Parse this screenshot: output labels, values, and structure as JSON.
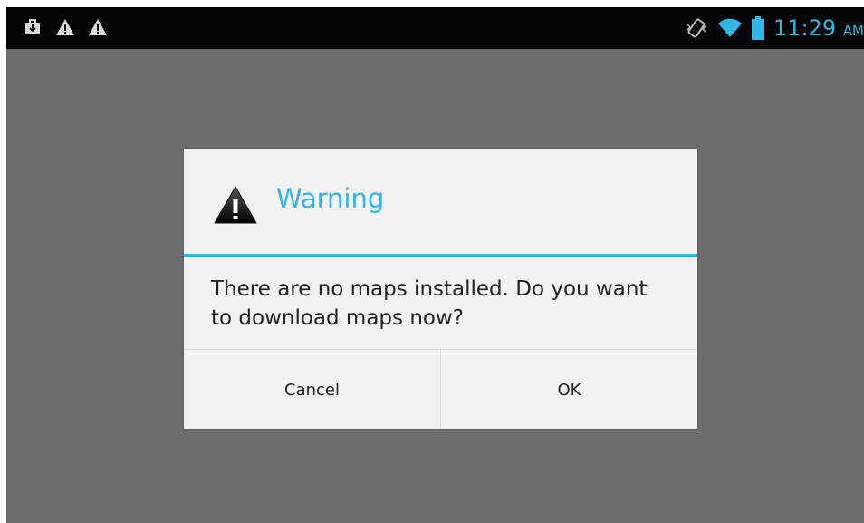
{
  "status_bar": {
    "notification_icons": [
      "download-briefcase-icon",
      "warning-icon",
      "warning-icon"
    ],
    "system_icons": [
      "vibrate-icon",
      "wifi-icon",
      "battery-icon"
    ],
    "time": "11:29",
    "ampm": "AM",
    "accent_color": "#33b5e5"
  },
  "dialog": {
    "title_icon": "warning-icon",
    "title": "Warning",
    "message": "There are no maps installed. Do you want to download maps now?",
    "buttons": {
      "cancel": "Cancel",
      "ok": "OK"
    },
    "accent_color": "#33b5e5",
    "background_color": "#f2f2f2"
  },
  "screen": {
    "dim_background_color": "#6d6d6d"
  }
}
